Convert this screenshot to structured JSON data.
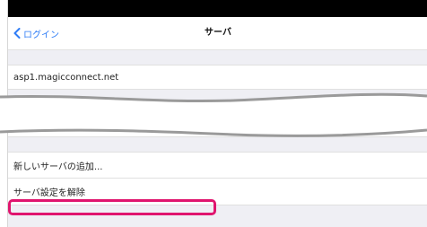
{
  "nav": {
    "back_label": "ログイン",
    "title": "サーバ"
  },
  "server": {
    "host": "asp1.magicconnect.net"
  },
  "actions": {
    "add_server": "新しいサーバの追加...",
    "remove_server_settings": "サーバ設定を解除"
  },
  "colors": {
    "accent": "#2f7df6",
    "highlight": "#e0156e",
    "group_background": "#efeff4"
  }
}
